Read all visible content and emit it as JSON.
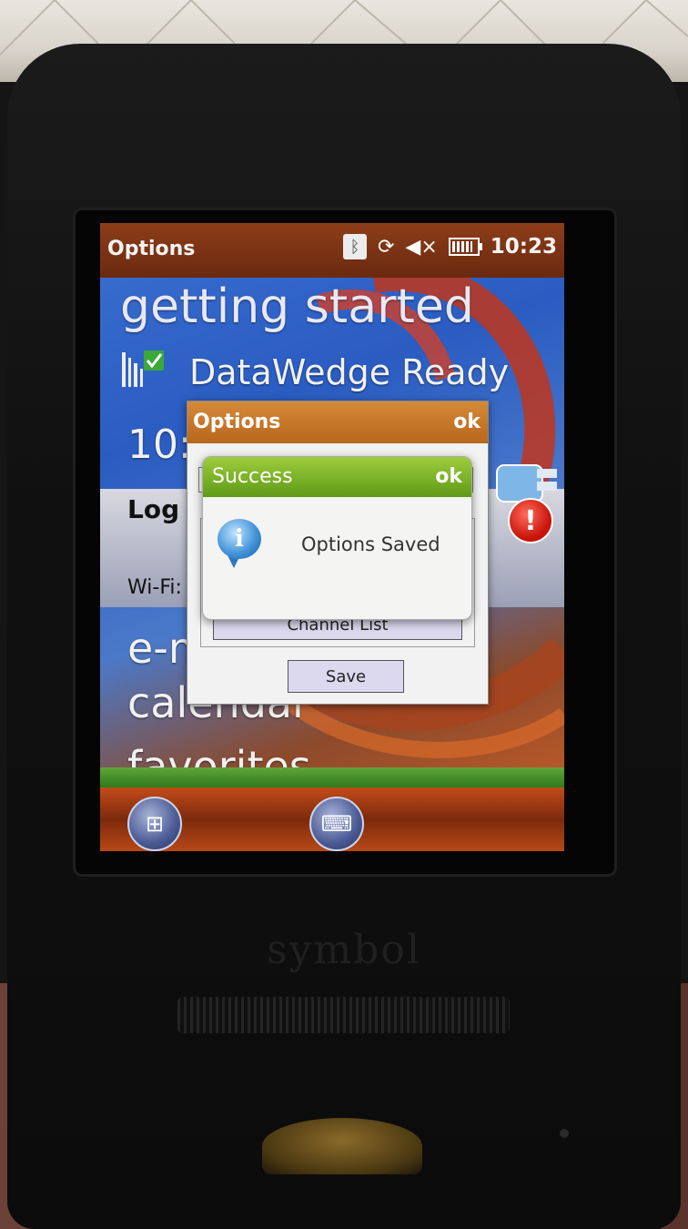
{
  "titlebar": {
    "title": "Options",
    "clock": "10:23",
    "icons": [
      "bluetooth-icon",
      "sync-icon",
      "speaker-mute-icon",
      "battery-icon"
    ]
  },
  "home": {
    "getting_started": "getting started",
    "datawedge": "DataWedge Ready",
    "clock_partial": "10:",
    "log_title": "Log",
    "wifi_label": "Wi-Fi:",
    "email": "e-m",
    "calendar": "calendar",
    "favorites": "favorites"
  },
  "options_dialog": {
    "title": "Options",
    "ok": "ok",
    "channel_list": "Channel List",
    "save": "Save"
  },
  "success_dialog": {
    "title": "Success",
    "ok": "ok",
    "message": "Options Saved"
  },
  "device": {
    "brand": "symbol"
  },
  "colors": {
    "titlebar": "#7a3314",
    "options_header": "#c8772a",
    "success_header": "#7eb52a",
    "alert": "#d0190d"
  }
}
